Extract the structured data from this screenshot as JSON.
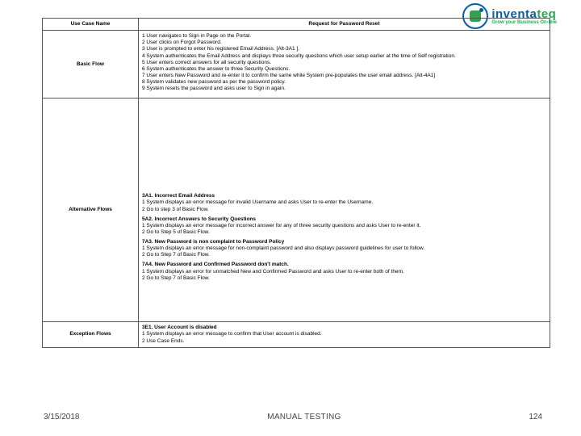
{
  "logo": {
    "line1_blue": "inventa",
    "line1_green": "teq",
    "line2": "Grow your Business On-line"
  },
  "table": {
    "header": {
      "left": "Use Case Name",
      "right": "Request for Password Reset"
    },
    "basicFlow": {
      "label": "Basic Flow",
      "lines": [
        "1 User navigates to Sign in Page on the Portal.",
        "2 User clicks on Forgot Password.",
        "3 User is prompted to enter his registered Email Address. [Alt-3A1 ].",
        "4 System authenticates the Email Address and displays three security questions which user setup earlier at the time of Self registration.",
        "5 User enters correct answers for all security questions.",
        "6 System authenticates the answer to three Security Questions.",
        "7 User enters New Password and re-enter it to confirm the same while System pre-populates the user email address. [Alt-4A1]",
        "8 System validates new password as per the password policy.",
        "9 System resets the password and asks user to Sign in again."
      ]
    },
    "altFlows": {
      "label": "Alternative Flows",
      "sections": [
        {
          "title": "3A1. Incorrect Email Address",
          "lines": [
            "1 System displays an error message for invalid Username and asks User to re-enter the Username.",
            "2 Go to step 3 of Basic Flow."
          ]
        },
        {
          "title": "5A2. Incorrect Answers to Security Questions",
          "lines": [
            "1 System displays an error message for incorrect answer for any of three security questions and asks User to re-enter it.",
            "2 Go to Step 5 of Basic Flow."
          ]
        },
        {
          "title": "7A3. New Password is non complaint to Password Policy",
          "lines": [
            "1 System displays an error message for non-complaint password and also displays password guidelines for user to follow.",
            "2 Go to Step 7 of Basic Flow."
          ]
        },
        {
          "title": "7A4. New Password and Confirmed Password don't match.",
          "lines": [
            "1 System displays an error for unmatched New and Confirmed Password and asks User to re-enter both of them.",
            "2 Go to Step 7 of Basic Flow."
          ]
        }
      ]
    },
    "excFlows": {
      "label": "Exception Flows",
      "sections": [
        {
          "title": "3E1. User Account is disabled",
          "lines": [
            "1 System displays an error message to confirm that User account is disabled.",
            "2 Use Case Ends."
          ]
        }
      ]
    }
  },
  "footer": {
    "date": "3/15/2018",
    "title": "MANUAL TESTING",
    "page": "124"
  }
}
